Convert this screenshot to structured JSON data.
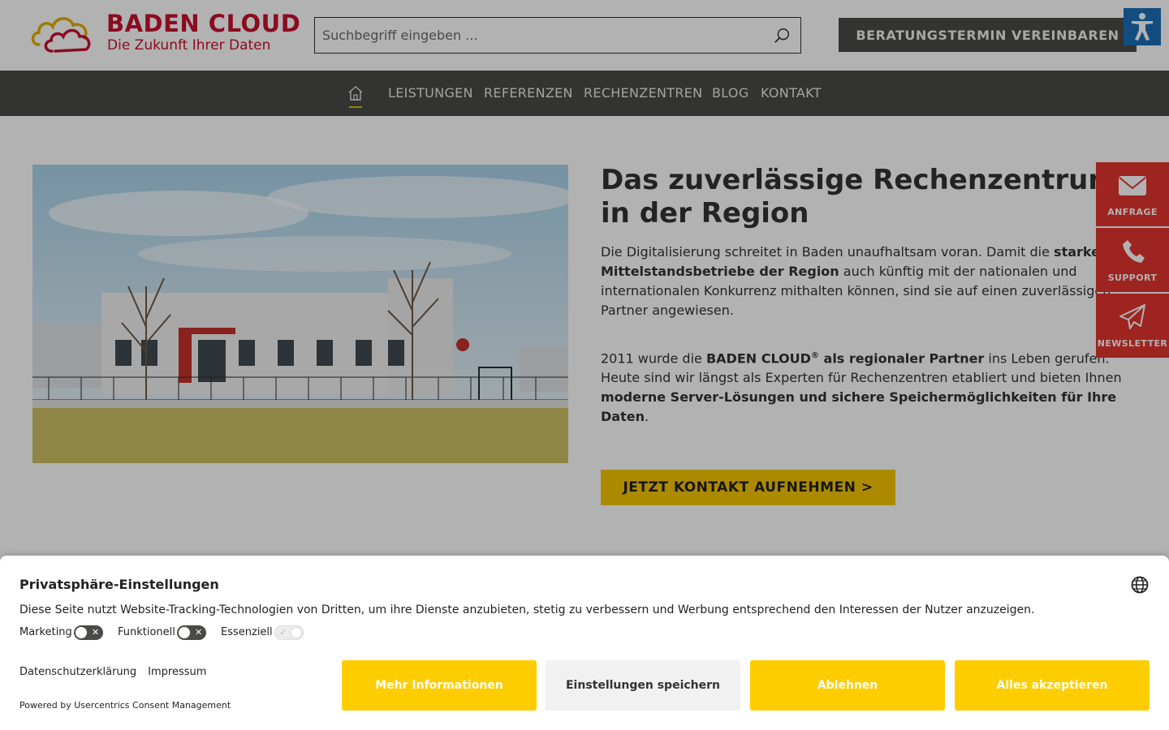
{
  "header": {
    "logo_title": "BADEN CLOUD",
    "logo_subtitle": "Die Zukunft Ihrer Daten",
    "search_placeholder": "Suchbegriff eingeben ...",
    "cta_label": "BERATUNGSTERMIN VEREINBAREN"
  },
  "nav": {
    "items": [
      "LEISTUNGEN",
      "REFERENZEN",
      "RECHENZENTREN",
      "BLOG",
      "KONTAKT"
    ]
  },
  "hero": {
    "title": "Das zuverlässige Rechenzentrum in der Region",
    "p1_a": "Die Digitalisierung schreitet in Baden unaufhaltsam voran. Damit die ",
    "p1_b": "starken Mittelstandsbetriebe der Region",
    "p1_c": " auch künftig mit der nationalen und internationalen Konkurrenz mithalten können, sind sie auf einen zuverlässigen Partner angewiesen.",
    "p2_a": "2011 wurde die ",
    "p2_b": "BADEN CLOUD",
    "p2_reg": "®",
    "p2_c": " als regionaler Partner",
    "p2_d": " ins Leben gerufen. Heute sind wir längst als Experten für Rechenzentren etabliert und bieten Ihnen ",
    "p2_e": "moderne Server-Lösungen und sichere Speichermöglichkeiten für Ihre Daten",
    "p2_f": ".",
    "cta_label": "JETZT KONTAKT AUFNEHMEN >"
  },
  "side_tabs": [
    "ANFRAGE",
    "SUPPORT",
    "NEWSLETTER"
  ],
  "consent": {
    "title": "Privatsphäre-Einstellungen",
    "description": "Diese Seite nutzt Website-Tracking-Technologien von Dritten, um ihre Dienste anzubieten, stetig zu verbessern und Werbung entsprechend den Interessen der Nutzer anzuzeigen.",
    "toggles": [
      {
        "label": "Marketing",
        "state": "off"
      },
      {
        "label": "Funktionell",
        "state": "off"
      },
      {
        "label": "Essenziell",
        "state": "on-disabled"
      }
    ],
    "links": [
      "Datenschutzerklärung",
      "Impressum"
    ],
    "powered_by": "Powered by Usercentrics Consent Management",
    "buttons": [
      "Mehr Informationen",
      "Einstellungen speichern",
      "Ablehnen",
      "Alles akzeptieren"
    ]
  },
  "colors": {
    "brand_red": "#c8102e",
    "nav_bg": "#4a4a48",
    "accent_yellow": "#f7c600",
    "side_tab_red": "#e3342f",
    "accessibility_blue": "#1a6fb8",
    "consent_yellow": "#fecd00"
  },
  "icons": [
    "cloud-logo-icon",
    "search-icon",
    "accessibility-icon",
    "home-icon",
    "mail-icon",
    "phone-icon",
    "paper-plane-icon",
    "globe-icon"
  ]
}
